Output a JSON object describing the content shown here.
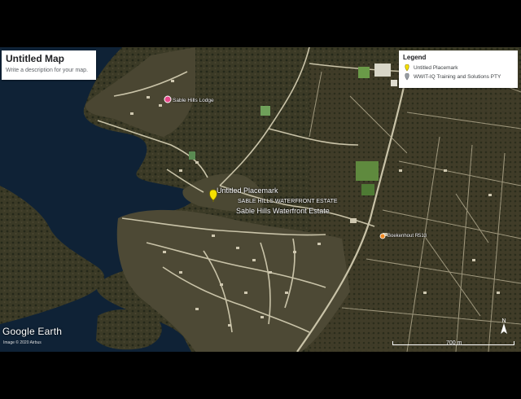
{
  "map_title": "Untitled Map",
  "map_description": "Write a description for your map.",
  "legend": {
    "title": "Legend",
    "items": [
      {
        "label": "Untitled Placemark",
        "icon": "yellow-pin-icon",
        "color": "#f5e000"
      },
      {
        "label": "WWIT-IQ Training and Solutions PTY",
        "icon": "gray-pin-icon",
        "color": "#9aa0a6"
      }
    ]
  },
  "places": {
    "lodge": "Sable Hills Lodge",
    "placemark": "Untitled Placemark",
    "estate_upper": "SABLE HILLS WATERFRONT ESTATE",
    "estate": "Sable Hills Waterfront Estate",
    "road": "Boekenhout R513"
  },
  "branding": {
    "logo": "Google Earth",
    "copyright": "Image © 2020 Airbus"
  },
  "scale_label": "700 m",
  "north_label": "N",
  "colors": {
    "water": "#0f2236",
    "land": "#3a3a24",
    "placemark": "#f5e000",
    "lodge_pin": "#e8488a"
  }
}
